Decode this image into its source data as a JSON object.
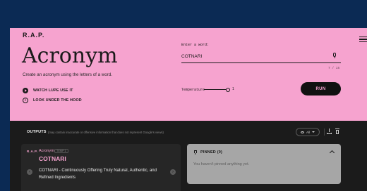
{
  "header": {
    "brand": "R.A.P.",
    "title": "Acronym",
    "subtitle": "Create an acronym using the letters of a word.",
    "links": {
      "watch": "WATCH LUPE USE IT",
      "under_hood": "LOOK UNDER THE HOOD"
    }
  },
  "input": {
    "label": "Enter a word:",
    "value": "COTNARI",
    "counter": "7 / 15"
  },
  "temperature": {
    "label": "Temperature",
    "value": "1",
    "level": 1.0
  },
  "run_label": "RUN",
  "outputs": {
    "title": "OUTPUTS",
    "note": "(may contain inaccurate or offensive information that does not represent Google's views)",
    "filter_label": "All"
  },
  "card": {
    "brand": "R.A.P.",
    "app": "Acronym",
    "temp_badge": "TEMP 1",
    "word": "COTNARI",
    "acronym": "COTNARI - Continuously Offering Truly Natural, Authentic, and Refined Ingredients"
  },
  "pinned": {
    "title": "PINNED (0)",
    "empty": "You haven't pinned anything yet."
  },
  "colors": {
    "page_bg": "#0b2a54",
    "pink": "#f6a3cf",
    "dark": "#1b1b1b",
    "card": "#262626",
    "pinned_panel": "#a6a6a6"
  },
  "icons": [
    "menu-icon",
    "play-icon",
    "info-icon",
    "mic-icon",
    "eye-icon",
    "download-icon",
    "trash-icon",
    "pin-icon",
    "chevron-left-icon",
    "chevron-right-icon",
    "chevron-up-icon"
  ]
}
